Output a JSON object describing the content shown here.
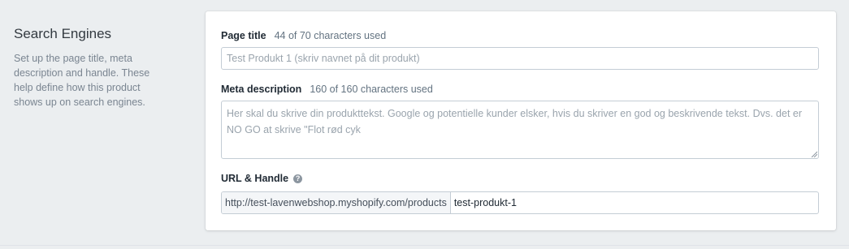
{
  "section": {
    "title": "Search Engines",
    "description": "Set up the page title, meta description and handle. These help define how this product shows up on search engines."
  },
  "page_title": {
    "label": "Page title",
    "counter": "44 of 70 characters used",
    "placeholder": "Test Produkt 1 (skriv navnet på dit produkt)"
  },
  "meta_description": {
    "label": "Meta description",
    "counter": "160 of 160 characters used",
    "placeholder": "Her skal du skrive din produkttekst. Google og potentielle kunder elsker, hvis du skriver en god og beskrivende tekst. Dvs. det er NO GO at skrive \"Flot rød cyk"
  },
  "url_handle": {
    "label": "URL & Handle",
    "help_icon": "question-mark-icon",
    "prefix": "http://test-lavenwebshop.myshopify.com/products",
    "handle_value": "test-produkt-1"
  }
}
